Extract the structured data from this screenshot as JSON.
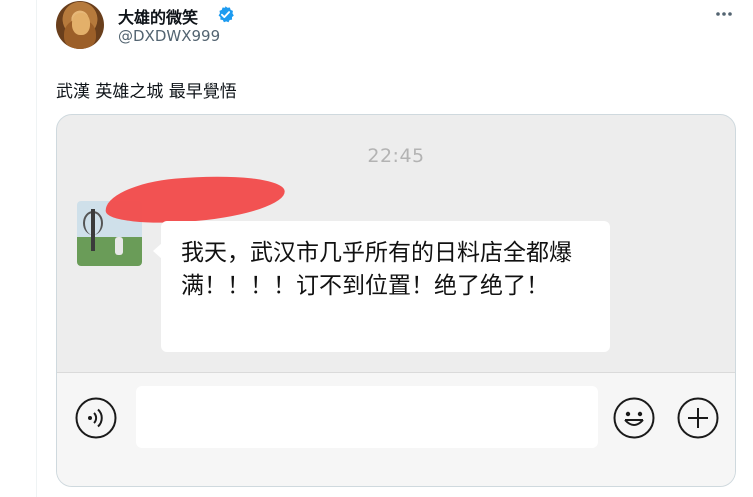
{
  "author": {
    "display_name": "大雄的微笑",
    "handle": "@DXDWX999",
    "avatar_icon": "lion-avatar",
    "verified_icon": "verified-badge-icon",
    "verified_color": "#1d9bf0"
  },
  "tweet": {
    "text": "武漢 英雄之城 最早覺悟"
  },
  "chat": {
    "time": "22:45",
    "message": "我天，武汉市几乎所有的日料店全都爆满！！！！订不到位置！绝了绝了！",
    "redaction_color": "#f24a4a",
    "input_placeholder": ""
  },
  "icons": {
    "voice": "voice-icon",
    "emoji": "emoji-icon",
    "plus": "plus-icon",
    "more": "more-icon"
  }
}
